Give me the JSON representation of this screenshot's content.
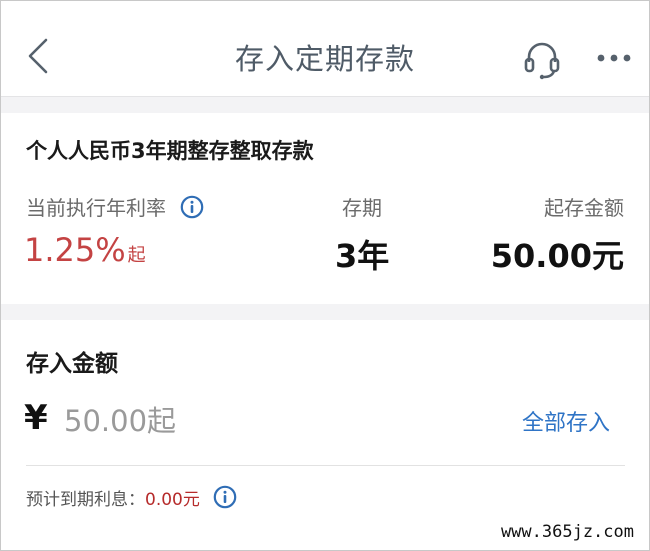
{
  "header": {
    "title": "存入定期存款",
    "back_icon": "chevron-left-icon",
    "service_icon": "headset-icon",
    "more_icon": "more-dots-icon"
  },
  "product": {
    "name": "个人人民币3年期整存整取存款",
    "rate_label": "当前执行年利率",
    "rate_value": "1.25%",
    "rate_suffix": "起",
    "term_label": "存期",
    "term_value": "3年",
    "min_label": "起存金额",
    "min_value": "50.00元"
  },
  "amount": {
    "title": "存入金额",
    "currency_symbol": "¥",
    "placeholder": "50.00起",
    "value": "",
    "deposit_all_label": "全部存入",
    "interest_label": "预计到期利息：",
    "interest_value": "0.00元"
  },
  "watermark": "www.365jz.com",
  "colors": {
    "accent_blue": "#2f74c6",
    "rate_red": "#c44343",
    "interest_red": "#b62b2b",
    "title_gray": "#4f5b67"
  }
}
